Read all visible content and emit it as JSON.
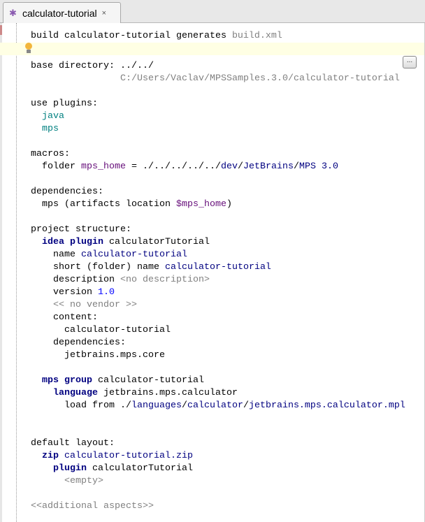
{
  "tab": {
    "title": "calculator-tutorial",
    "close": "×",
    "icon": "mps-bug-icon"
  },
  "more_button": "...",
  "lines": [
    [
      {
        "t": "build calculator-tutorial generates ",
        "s": "k"
      },
      {
        "t": "build.xml",
        "s": "g"
      }
    ],
    [
      {
        "t": "base directory: ",
        "s": "k"
      },
      {
        "t": "../../",
        "s": "k"
      }
    ],
    [
      {
        "t": "C:/Users/Vaclav/MPSSamples.3.0/calculator-tutorial",
        "s": "g"
      }
    ],
    [
      {
        "t": "use plugins:",
        "s": "k"
      }
    ],
    [
      {
        "t": "java",
        "s": "t"
      }
    ],
    [
      {
        "t": "mps",
        "s": "t"
      }
    ],
    [
      {
        "t": "macros:",
        "s": "k"
      }
    ],
    [
      {
        "t": "folder ",
        "s": "k"
      },
      {
        "t": "mps_home",
        "s": "p"
      },
      {
        "t": " = ./../../../../",
        "s": "k"
      },
      {
        "t": "dev",
        "s": "n"
      },
      {
        "t": "/",
        "s": "k"
      },
      {
        "t": "JetBrains",
        "s": "n"
      },
      {
        "t": "/",
        "s": "k"
      },
      {
        "t": "MPS 3.0",
        "s": "n"
      }
    ],
    [
      {
        "t": "dependencies:",
        "s": "k"
      }
    ],
    [
      {
        "t": "mps (artifacts location ",
        "s": "k"
      },
      {
        "t": "$mps_home",
        "s": "p"
      },
      {
        "t": ")",
        "s": "k"
      }
    ],
    [
      {
        "t": "project structure:",
        "s": "k"
      }
    ],
    [
      {
        "t": "idea plugin ",
        "s": "kb"
      },
      {
        "t": "calculatorTutorial",
        "s": "k"
      }
    ],
    [
      {
        "t": "name ",
        "s": "k"
      },
      {
        "t": "calculator-tutorial",
        "s": "n"
      }
    ],
    [
      {
        "t": "short (folder) name ",
        "s": "k"
      },
      {
        "t": "calculator-tutorial",
        "s": "n"
      }
    ],
    [
      {
        "t": "description ",
        "s": "k"
      },
      {
        "t": "<no description>",
        "s": "g"
      }
    ],
    [
      {
        "t": "version ",
        "s": "k"
      },
      {
        "t": "1.0",
        "s": "b"
      }
    ],
    [
      {
        "t": "<< no vendor >>",
        "s": "g"
      }
    ],
    [
      {
        "t": "content:",
        "s": "k"
      }
    ],
    [
      {
        "t": "calculator-tutorial",
        "s": "k"
      }
    ],
    [
      {
        "t": "dependencies:",
        "s": "k"
      }
    ],
    [
      {
        "t": "jetbrains.mps.core",
        "s": "k"
      }
    ],
    [
      {
        "t": "mps group ",
        "s": "kb"
      },
      {
        "t": "calculator-tutorial",
        "s": "k"
      }
    ],
    [
      {
        "t": "language ",
        "s": "kb"
      },
      {
        "t": "jetbrains.mps.calculator",
        "s": "k"
      }
    ],
    [
      {
        "t": "load from ./",
        "s": "k"
      },
      {
        "t": "languages",
        "s": "n"
      },
      {
        "t": "/",
        "s": "k"
      },
      {
        "t": "calculator",
        "s": "n"
      },
      {
        "t": "/",
        "s": "k"
      },
      {
        "t": "jetbrains.mps.calculator.mpl",
        "s": "n"
      }
    ],
    [
      {
        "t": "default layout:",
        "s": "k"
      }
    ],
    [
      {
        "t": "zip ",
        "s": "kb"
      },
      {
        "t": "calculator-tutorial.zip",
        "s": "n"
      }
    ],
    [
      {
        "t": "plugin ",
        "s": "kb"
      },
      {
        "t": "calculatorTutorial",
        "s": "k"
      }
    ],
    [
      {
        "t": "<empty>",
        "s": "g"
      }
    ],
    [
      {
        "t": "<<additional aspects>>",
        "s": "g"
      }
    ]
  ]
}
